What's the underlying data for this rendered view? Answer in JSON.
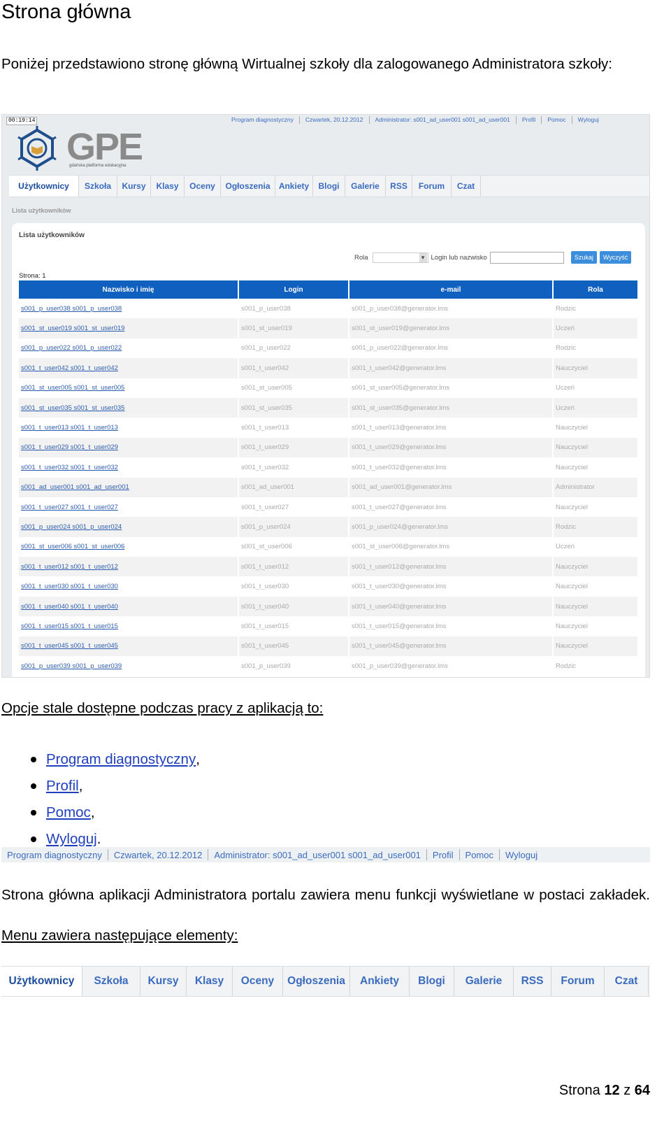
{
  "doc": {
    "title": "Strona główna",
    "intro": "Poniżej przedstawiono stronę główną Wirtualnej szkoły dla zalogowanego Administratora szkoły:",
    "options_heading": "Opcje stale dostępne podczas pracy z aplikacją to:",
    "options": [
      {
        "label": "Program diagnostyczny",
        "suffix": ","
      },
      {
        "label": "Profil",
        "suffix": ","
      },
      {
        "label": "Pomoc",
        "suffix": ","
      },
      {
        "label": "Wyloguj",
        "suffix": "."
      }
    ],
    "menu_desc": "Strona główna aplikacji Administratora portalu zawiera menu funkcji wyświetlane w postaci zakładek.",
    "menu_heading": "Menu zawiera następujące elementy:",
    "footer": {
      "prefix": "Strona",
      "page": "12",
      "of": "z",
      "total": "64"
    }
  },
  "app": {
    "clock": "00:19:14",
    "logo": {
      "text": "GPE",
      "subtitle": "gdańska platforma edukacyjna"
    },
    "topbar": [
      "Program diagnostyczny",
      "Czwartek, 20.12.2012",
      "Administrator: s001_ad_user001 s001_ad_user001",
      "Profil",
      "Pomoc",
      "Wyloguj"
    ],
    "tabs": [
      "Użytkownicy",
      "Szkoła",
      "Kursy",
      "Klasy",
      "Oceny",
      "Ogłoszenia",
      "Ankiety",
      "Blogi",
      "Galerie",
      "RSS",
      "Forum",
      "Czat"
    ],
    "active_tab": "Użytkownicy",
    "breadcrumb": "Lista użytkowników",
    "panel_title": "Lista użytkowników",
    "filters": {
      "role_label": "Rola",
      "login_label": "Login lub nazwisko",
      "search_button": "Szukaj",
      "clear_button": "Wyczyść"
    },
    "page_label": "Strona: 1",
    "columns": [
      "Nazwisko i imię",
      "Login",
      "e-mail",
      "Rola"
    ],
    "rows": [
      [
        "s001_p_user038 s001_p_user038",
        "s001_p_user038",
        "s001_p_user038@generator.lms",
        "Rodzic"
      ],
      [
        "s001_st_user019 s001_st_user019",
        "s001_st_user019",
        "s001_st_user019@generator.lms",
        "Uczeń"
      ],
      [
        "s001_p_user022 s001_p_user022",
        "s001_p_user022",
        "s001_p_user022@generator.lms",
        "Rodzic"
      ],
      [
        "s001_t_user042 s001_t_user042",
        "s001_t_user042",
        "s001_t_user042@generator.lms",
        "Nauczyciel"
      ],
      [
        "s001_st_user005 s001_st_user005",
        "s001_st_user005",
        "s001_st_user005@generator.lms",
        "Uczeń"
      ],
      [
        "s001_st_user035 s001_st_user035",
        "s001_st_user035",
        "s001_st_user035@generator.lms",
        "Uczeń"
      ],
      [
        "s001_t_user013 s001_t_user013",
        "s001_t_user013",
        "s001_t_user013@generator.lms",
        "Nauczyciel"
      ],
      [
        "s001_t_user029 s001_t_user029",
        "s001_t_user029",
        "s001_t_user029@generator.lms",
        "Nauczyciel"
      ],
      [
        "s001_t_user032 s001_t_user032",
        "s001_t_user032",
        "s001_t_user032@generator.lms",
        "Nauczyciel"
      ],
      [
        "s001_ad_user001 s001_ad_user001",
        "s001_ad_user001",
        "s001_ad_user001@generator.lms",
        "Administrator"
      ],
      [
        "s001_t_user027 s001_t_user027",
        "s001_t_user027",
        "s001_t_user027@generator.lms",
        "Nauczyciel"
      ],
      [
        "s001_p_user024 s001_p_user024",
        "s001_p_user024",
        "s001_p_user024@generator.lms",
        "Rodzic"
      ],
      [
        "s001_st_user006 s001_st_user006",
        "s001_st_user006",
        "s001_st_user006@generator.lms",
        "Uczeń"
      ],
      [
        "s001_t_user012 s001_t_user012",
        "s001_t_user012",
        "s001_t_user012@generator.lms",
        "Nauczyciel"
      ],
      [
        "s001_t_user030 s001_t_user030",
        "s001_t_user030",
        "s001_t_user030@generator.lms",
        "Nauczyciel"
      ],
      [
        "s001_t_user040 s001_t_user040",
        "s001_t_user040",
        "s001_t_user040@generator.lms",
        "Nauczyciel"
      ],
      [
        "s001_t_user015 s001_t_user015",
        "s001_t_user015",
        "s001_t_user015@generator.lms",
        "Nauczyciel"
      ],
      [
        "s001_t_user045 s001_t_user045",
        "s001_t_user045",
        "s001_t_user045@generator.lms",
        "Nauczyciel"
      ],
      [
        "s001_p_user039 s001_p_user039",
        "s001_p_user039",
        "s001_p_user039@generator.lms",
        "Rodzic"
      ]
    ]
  }
}
